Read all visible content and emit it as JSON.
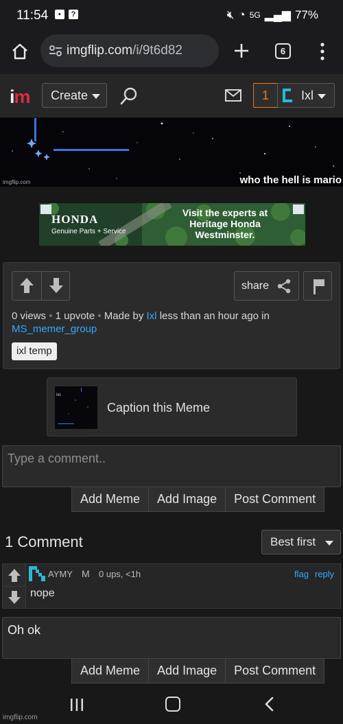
{
  "status_bar": {
    "time": "11:54",
    "network": "5G",
    "battery": "77%"
  },
  "browser": {
    "url_domain": "imgflip.com",
    "url_path": "/i/9t6d82",
    "tab_count": "6"
  },
  "header": {
    "logo_i": "i",
    "logo_m": "m",
    "create_label": "Create",
    "notification_count": "1",
    "username": "Ixl"
  },
  "meme": {
    "caption": "who the hell is mario",
    "watermark": "imgflip.com"
  },
  "ad": {
    "brand": "HONDA",
    "brand_sub": "Genuine Parts + Service",
    "message": "Visit the experts at Heritage Honda Westminster."
  },
  "meme_info": {
    "share_label": "share",
    "views": "0 views",
    "separator": "•",
    "upvotes": "1 upvote",
    "made_by_prefix": "Made by",
    "author": "Ixl",
    "time_text": "less than an hour ago in",
    "stream": "MS_memer_group",
    "tag": "ixl temp"
  },
  "caption_card": {
    "label": "Caption this Meme"
  },
  "comment_form": {
    "placeholder": "Type a comment..",
    "add_meme": "Add Meme",
    "add_image": "Add Image",
    "post_comment": "Post Comment"
  },
  "comments": {
    "title": "1 Comment",
    "sort_label": "Best first",
    "items": [
      {
        "author": "AYMY",
        "badge": "M",
        "meta": "0 ups, <1h",
        "flag": "flag",
        "reply": "reply",
        "text": "nope"
      }
    ]
  },
  "reply_form": {
    "value": "Oh ok",
    "add_meme": "Add Meme",
    "add_image": "Add Image",
    "post_comment": "Post Comment"
  },
  "footer": {
    "watermark": "imgflip.com"
  },
  "colors": {
    "accent_blue": "#33aaff",
    "logo_red": "#e0293c",
    "notification_orange": "#f07a1a"
  }
}
